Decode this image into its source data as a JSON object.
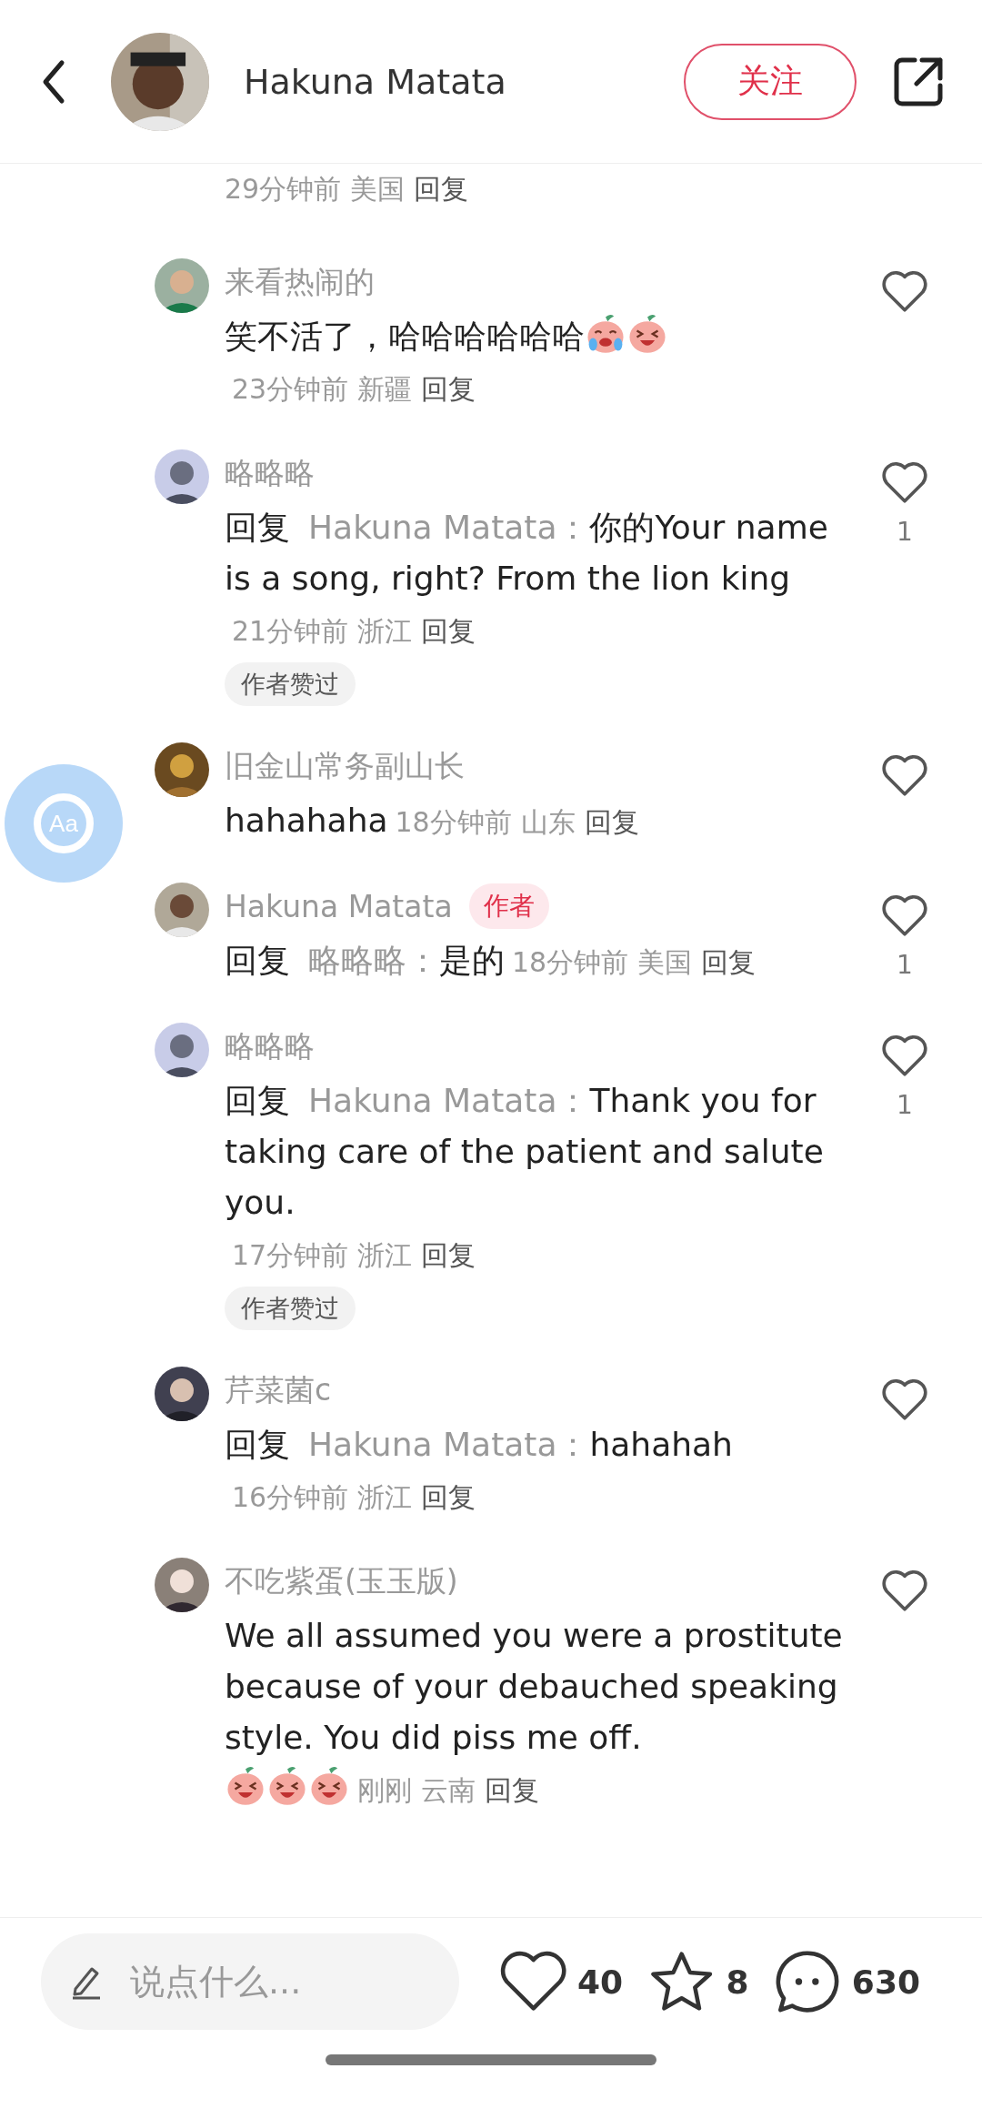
{
  "header": {
    "name": "Hakuna Matata",
    "follow_label": "关注"
  },
  "partial_meta": {
    "time": "29分钟前",
    "location": "美国",
    "reply": "回复"
  },
  "comments": [
    {
      "name": "来看热闹的",
      "text": "笑不活了，哈哈哈哈哈哈",
      "emojis": [
        {
          "kind": "crying"
        },
        {
          "kind": "laughing"
        }
      ],
      "time": "23分钟前",
      "location": "新疆",
      "reply": "回复",
      "liked": false
    },
    {
      "name": "略略略",
      "reply_label": "回复",
      "reply_target": "Hakuna Matata：",
      "text": "你的Your name is a song, right? From the lion king",
      "time": "21分钟前",
      "location": "浙江",
      "reply": "回复",
      "tag": "作者赞过",
      "liked": false,
      "likes": "1"
    },
    {
      "name": "旧金山常务副山长",
      "text": "hahahaha",
      "time": "18分钟前",
      "location": "山东",
      "reply": "回复",
      "liked": false
    },
    {
      "name": "Hakuna Matata",
      "badge": "作者",
      "reply_label": "回复",
      "reply_target": "略略略：",
      "text": "是的",
      "time": "18分钟前",
      "location": "美国",
      "reply": "回复",
      "liked": false,
      "likes": "1"
    },
    {
      "name": "略略略",
      "reply_label": "回复",
      "reply_target": "Hakuna Matata：",
      "text": "Thank you for taking care of the patient and salute you.",
      "time": "17分钟前",
      "location": "浙江",
      "reply": "回复",
      "tag": "作者赞过",
      "liked": false,
      "likes": "1"
    },
    {
      "name": "芹菜菌c",
      "reply_label": "回复",
      "reply_target": "Hakuna Matata：",
      "text": "hahahah",
      "time": "16分钟前",
      "location": "浙江",
      "reply": "回复",
      "liked": false
    },
    {
      "name": "不吃紫蛋(玉玉版)",
      "text": "We all assumed you were a prostitute because of your debauched speaking style. You did piss me off.",
      "emojis": [
        {
          "kind": "laughing"
        },
        {
          "kind": "laughing"
        },
        {
          "kind": "laughing"
        }
      ],
      "time": "刚刚",
      "location": "云南",
      "reply": "回复",
      "liked": false
    }
  ],
  "float_button": {
    "label": "Aa"
  },
  "bottom_bar": {
    "placeholder": "说点什么...",
    "likes": "40",
    "stars": "8",
    "comments": "630"
  }
}
